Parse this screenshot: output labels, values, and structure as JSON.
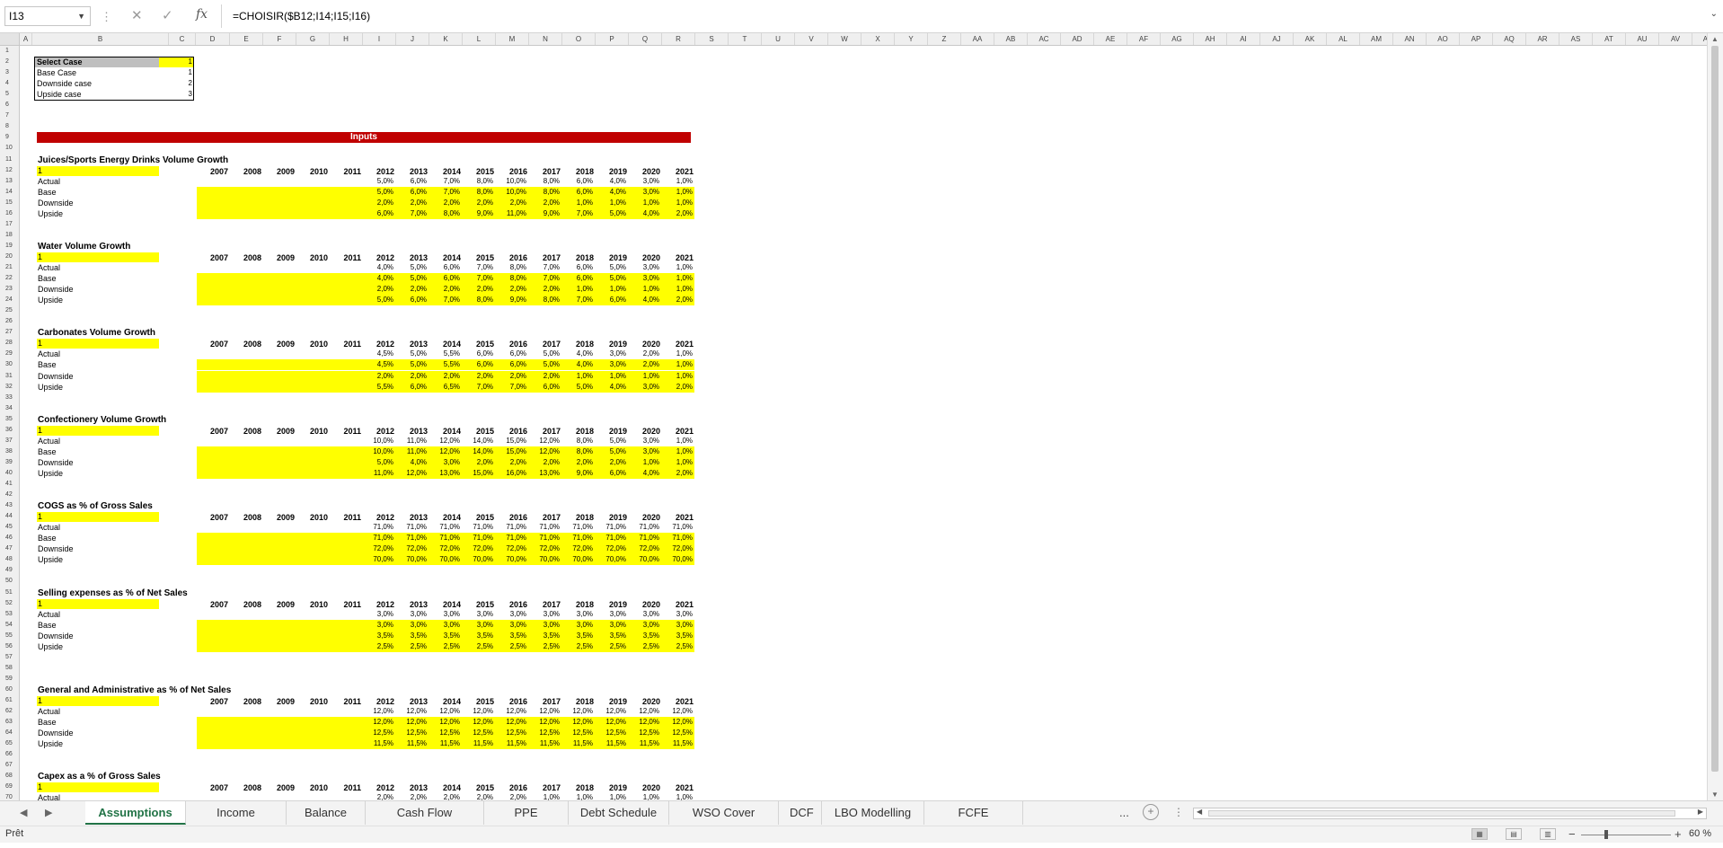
{
  "formula_bar": {
    "name_box": "I13",
    "separator": "⋮",
    "cancel_glyph": "✕",
    "enter_glyph": "✓",
    "fx_label": "fx",
    "formula": "=CHOISIR($B12;I14;I15;I16)"
  },
  "column_headers": [
    "A",
    "B",
    "C",
    "D",
    "E",
    "F",
    "G",
    "H",
    "I",
    "J",
    "K",
    "L",
    "M",
    "N",
    "O",
    "P",
    "Q",
    "R",
    "S",
    "T",
    "U",
    "V",
    "W",
    "X",
    "Y",
    "Z",
    "AA",
    "AB",
    "AC",
    "AD",
    "AE",
    "AF",
    "AG",
    "AH",
    "AI",
    "AJ",
    "AK",
    "AL",
    "AM",
    "AN",
    "AO",
    "AP",
    "AQ",
    "AR",
    "AS",
    "AT",
    "AU",
    "AV",
    "AW"
  ],
  "row_numbers": [
    "1",
    "2",
    "3",
    "4",
    "5",
    "6",
    "7",
    "8",
    "9",
    "10",
    "11",
    "12",
    "13",
    "14",
    "15",
    "16",
    "17",
    "18",
    "19",
    "20",
    "21",
    "22",
    "23",
    "24",
    "25",
    "26",
    "27",
    "28",
    "29",
    "30",
    "31",
    "32",
    "33",
    "34",
    "35",
    "36",
    "37",
    "38",
    "39",
    "40",
    "41",
    "42",
    "43",
    "44",
    "45",
    "46",
    "47",
    "48",
    "49",
    "50",
    "51",
    "52",
    "53",
    "54",
    "55",
    "56",
    "57",
    "58",
    "59",
    "60",
    "61",
    "62",
    "63",
    "64",
    "65",
    "66",
    "67",
    "68",
    "69",
    "70"
  ],
  "select_case": {
    "title": "Select Case",
    "value": "1",
    "options": [
      {
        "label": "Base Case",
        "value": "1"
      },
      {
        "label": "Downside case",
        "value": "2"
      },
      {
        "label": "Upside case",
        "value": "3"
      }
    ]
  },
  "inputs_banner": "Inputs",
  "years": [
    "2007",
    "2008",
    "2009",
    "2010",
    "2011",
    "2012",
    "2013",
    "2014",
    "2015",
    "2016",
    "2017",
    "2018",
    "2019",
    "2020",
    "2021"
  ],
  "row_labels": [
    "Actual",
    "Base",
    "Downside",
    "Upside"
  ],
  "sections": [
    {
      "title": "Juices/Sports Energy Drinks Volume Growth",
      "case": "1",
      "rows": [
        [
          "5,0%",
          "6,0%",
          "7,0%",
          "8,0%",
          "10,0%",
          "8,0%",
          "6,0%",
          "4,0%",
          "3,0%",
          "1,0%"
        ],
        [
          "5,0%",
          "6,0%",
          "7,0%",
          "8,0%",
          "10,0%",
          "8,0%",
          "6,0%",
          "4,0%",
          "3,0%",
          "1,0%"
        ],
        [
          "2,0%",
          "2,0%",
          "2,0%",
          "2,0%",
          "2,0%",
          "2,0%",
          "1,0%",
          "1,0%",
          "1,0%",
          "1,0%"
        ],
        [
          "6,0%",
          "7,0%",
          "8,0%",
          "9,0%",
          "11,0%",
          "9,0%",
          "7,0%",
          "5,0%",
          "4,0%",
          "2,0%"
        ]
      ]
    },
    {
      "title": "Water Volume Growth",
      "case": "1",
      "rows": [
        [
          "4,0%",
          "5,0%",
          "6,0%",
          "7,0%",
          "8,0%",
          "7,0%",
          "6,0%",
          "5,0%",
          "3,0%",
          "1,0%"
        ],
        [
          "4,0%",
          "5,0%",
          "6,0%",
          "7,0%",
          "8,0%",
          "7,0%",
          "6,0%",
          "5,0%",
          "3,0%",
          "1,0%"
        ],
        [
          "2,0%",
          "2,0%",
          "2,0%",
          "2,0%",
          "2,0%",
          "2,0%",
          "1,0%",
          "1,0%",
          "1,0%",
          "1,0%"
        ],
        [
          "5,0%",
          "6,0%",
          "7,0%",
          "8,0%",
          "9,0%",
          "8,0%",
          "7,0%",
          "6,0%",
          "4,0%",
          "2,0%"
        ]
      ]
    },
    {
      "title": "Carbonates Volume Growth",
      "case": "1",
      "rows": [
        [
          "4,5%",
          "5,0%",
          "5,5%",
          "6,0%",
          "6,0%",
          "5,0%",
          "4,0%",
          "3,0%",
          "2,0%",
          "1,0%"
        ],
        [
          "4,5%",
          "5,0%",
          "5,5%",
          "6,0%",
          "6,0%",
          "5,0%",
          "4,0%",
          "3,0%",
          "2,0%",
          "1,0%"
        ],
        [
          "2,0%",
          "2,0%",
          "2,0%",
          "2,0%",
          "2,0%",
          "2,0%",
          "1,0%",
          "1,0%",
          "1,0%",
          "1,0%"
        ],
        [
          "5,5%",
          "6,0%",
          "6,5%",
          "7,0%",
          "7,0%",
          "6,0%",
          "5,0%",
          "4,0%",
          "3,0%",
          "2,0%"
        ]
      ]
    },
    {
      "title": "Confectionery Volume Growth",
      "case": "1",
      "rows": [
        [
          "10,0%",
          "11,0%",
          "12,0%",
          "14,0%",
          "15,0%",
          "12,0%",
          "8,0%",
          "5,0%",
          "3,0%",
          "1,0%"
        ],
        [
          "10,0%",
          "11,0%",
          "12,0%",
          "14,0%",
          "15,0%",
          "12,0%",
          "8,0%",
          "5,0%",
          "3,0%",
          "1,0%"
        ],
        [
          "5,0%",
          "4,0%",
          "3,0%",
          "2,0%",
          "2,0%",
          "2,0%",
          "2,0%",
          "2,0%",
          "1,0%",
          "1,0%"
        ],
        [
          "11,0%",
          "12,0%",
          "13,0%",
          "15,0%",
          "16,0%",
          "13,0%",
          "9,0%",
          "6,0%",
          "4,0%",
          "2,0%"
        ]
      ]
    },
    {
      "title": "COGS as % of Gross Sales",
      "case": "1",
      "rows": [
        [
          "71,0%",
          "71,0%",
          "71,0%",
          "71,0%",
          "71,0%",
          "71,0%",
          "71,0%",
          "71,0%",
          "71,0%",
          "71,0%"
        ],
        [
          "71,0%",
          "71,0%",
          "71,0%",
          "71,0%",
          "71,0%",
          "71,0%",
          "71,0%",
          "71,0%",
          "71,0%",
          "71,0%"
        ],
        [
          "72,0%",
          "72,0%",
          "72,0%",
          "72,0%",
          "72,0%",
          "72,0%",
          "72,0%",
          "72,0%",
          "72,0%",
          "72,0%"
        ],
        [
          "70,0%",
          "70,0%",
          "70,0%",
          "70,0%",
          "70,0%",
          "70,0%",
          "70,0%",
          "70,0%",
          "70,0%",
          "70,0%"
        ]
      ]
    },
    {
      "title": "Selling expenses as % of Net Sales",
      "case": "1",
      "rows": [
        [
          "3,0%",
          "3,0%",
          "3,0%",
          "3,0%",
          "3,0%",
          "3,0%",
          "3,0%",
          "3,0%",
          "3,0%",
          "3,0%"
        ],
        [
          "3,0%",
          "3,0%",
          "3,0%",
          "3,0%",
          "3,0%",
          "3,0%",
          "3,0%",
          "3,0%",
          "3,0%",
          "3,0%"
        ],
        [
          "3,5%",
          "3,5%",
          "3,5%",
          "3,5%",
          "3,5%",
          "3,5%",
          "3,5%",
          "3,5%",
          "3,5%",
          "3,5%"
        ],
        [
          "2,5%",
          "2,5%",
          "2,5%",
          "2,5%",
          "2,5%",
          "2,5%",
          "2,5%",
          "2,5%",
          "2,5%",
          "2,5%"
        ]
      ]
    },
    {
      "title": "General and Administrative as % of Net Sales",
      "case": "1",
      "rows": [
        [
          "12,0%",
          "12,0%",
          "12,0%",
          "12,0%",
          "12,0%",
          "12,0%",
          "12,0%",
          "12,0%",
          "12,0%",
          "12,0%"
        ],
        [
          "12,0%",
          "12,0%",
          "12,0%",
          "12,0%",
          "12,0%",
          "12,0%",
          "12,0%",
          "12,0%",
          "12,0%",
          "12,0%"
        ],
        [
          "12,5%",
          "12,5%",
          "12,5%",
          "12,5%",
          "12,5%",
          "12,5%",
          "12,5%",
          "12,5%",
          "12,5%",
          "12,5%"
        ],
        [
          "11,5%",
          "11,5%",
          "11,5%",
          "11,5%",
          "11,5%",
          "11,5%",
          "11,5%",
          "11,5%",
          "11,5%",
          "11,5%"
        ]
      ]
    },
    {
      "title": "Capex as a % of Gross Sales",
      "case": "1",
      "rows": [
        [
          "2,0%",
          "2,0%",
          "2,0%",
          "2,0%",
          "2,0%",
          "1,0%",
          "1,0%",
          "1,0%",
          "1,0%",
          "1,0%"
        ]
      ]
    }
  ],
  "tabs": [
    "Assumptions",
    "Income Statement",
    "Balance Sheet",
    "Cash Flow Statement",
    "PPE Schedule",
    "Debt Schedule",
    "WSO Cover Page",
    "DCF",
    "LBO Modelling",
    "FCFE Valuation"
  ],
  "active_tab": "Assumptions",
  "tab_more": "...",
  "tab_add": "+",
  "status": {
    "ready": "Prêt",
    "zoom": "60 %",
    "zoom_level_percent": 60,
    "zoom_minus": "−",
    "zoom_plus": "+"
  },
  "icons": {
    "sheet_prev": "◀",
    "sheet_next": "▶",
    "scroll_up": "▲",
    "scroll_down": "▼",
    "scroll_left": "◀",
    "scroll_right": "▶",
    "expand": "⌄"
  },
  "colors": {
    "input_yellow": "#ffff00",
    "banner_red": "#c00000",
    "active_tab_green": "#217346"
  }
}
